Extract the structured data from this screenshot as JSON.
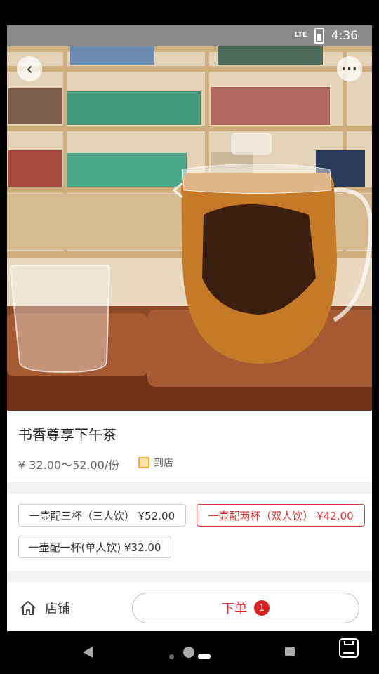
{
  "status_bar": {
    "network": "LTE",
    "time": "4:36"
  },
  "product": {
    "title": "书香尊享下午茶",
    "price": "¥ 32.00～52.00/份",
    "service_tag": "到店"
  },
  "options": [
    {
      "label": "一壶配三杯（三人饮） ¥52.00",
      "selected": false
    },
    {
      "label": "一壶配两杯（双人饮） ¥42.00",
      "selected": true
    },
    {
      "label": "一壶配一杯(单人饮) ¥32.00",
      "selected": false
    }
  ],
  "bottom_bar": {
    "shop_label": "店铺",
    "order_label": "下单",
    "order_count": "1"
  },
  "colors": {
    "accent": "#e03030",
    "tag": "#f3b23a"
  },
  "icons": {
    "back": "chevron-left-icon",
    "more": "more-icon",
    "shop": "home-icon",
    "tag": "store-tag-icon"
  }
}
